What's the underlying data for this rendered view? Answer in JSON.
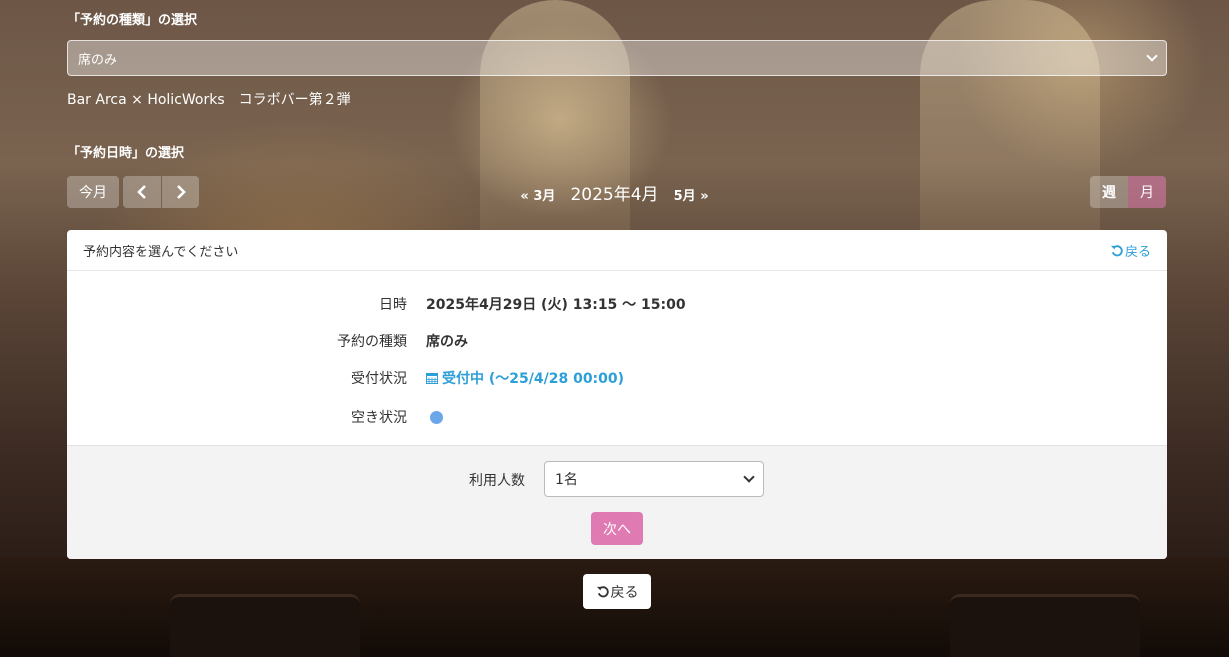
{
  "reservation_type": {
    "heading": "「予約の種類」の選択",
    "selected": "席のみ"
  },
  "event_title": "Bar Arca × HolicWorks　コラボバー第２弾",
  "datetime_section": {
    "heading": "「予約日時」の選択",
    "today_label": "今月",
    "prev_month": "3月",
    "current_month": "2025年4月",
    "next_month": "5月",
    "view_week": "週",
    "view_month": "月"
  },
  "card": {
    "header_text": "予約内容を選んでください",
    "back_label": "戻る",
    "details": [
      {
        "key": "日時",
        "value": "2025年4月29日 (火) 13:15 〜 15:00"
      },
      {
        "key": "予約の種類",
        "value": "席のみ"
      },
      {
        "key": "受付状況",
        "value": "受付中 (〜25/4/28 00:00)"
      },
      {
        "key": "空き状況",
        "value": ""
      }
    ],
    "people_label": "利用人数",
    "people_selected": "1名",
    "next_label": "次へ"
  },
  "bottom_back_label": "戻る",
  "colors": {
    "accent_pink": "#e07ab2",
    "link_blue": "#2d9fd8",
    "availability_dot": "#6aa7e8"
  }
}
